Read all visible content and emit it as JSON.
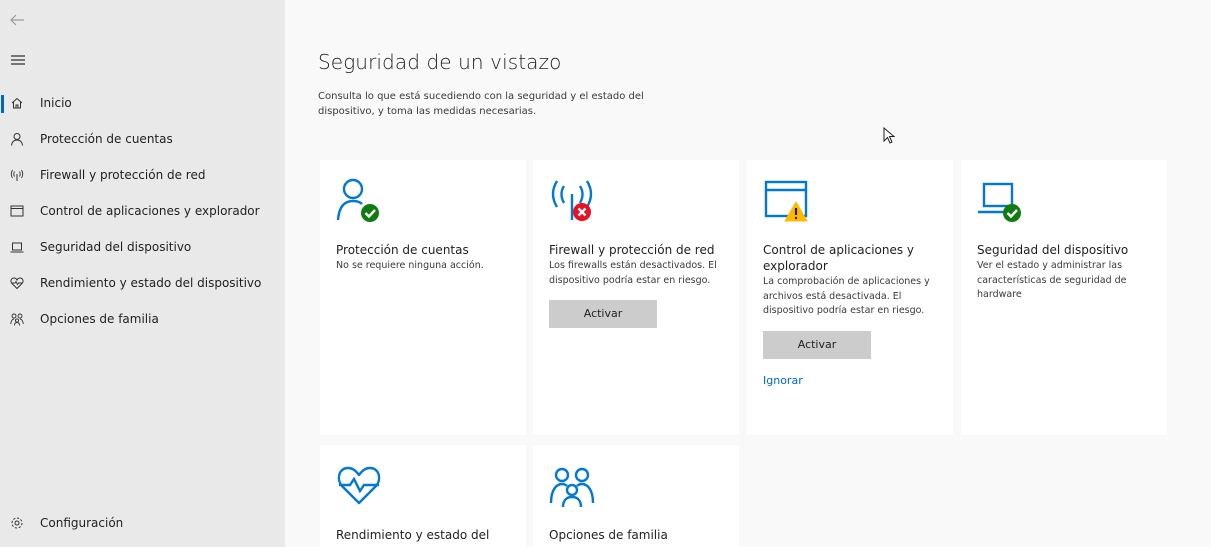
{
  "sidebar": {
    "items": [
      {
        "label": "Inicio",
        "icon": "home-icon",
        "active": true
      },
      {
        "label": "Protección de cuentas",
        "icon": "person-icon"
      },
      {
        "label": "Firewall y protección de red",
        "icon": "antenna-icon"
      },
      {
        "label": "Control de aplicaciones y explorador",
        "icon": "browser-window-icon"
      },
      {
        "label": "Seguridad del dispositivo",
        "icon": "laptop-icon"
      },
      {
        "label": "Rendimiento y estado del dispositivo",
        "icon": "heart-pulse-icon"
      },
      {
        "label": "Opciones de familia",
        "icon": "family-icon"
      }
    ],
    "settings_label": "Configuración"
  },
  "main": {
    "title": "Seguridad de un vistazo",
    "subtitle": "Consulta lo que está sucediendo con la seguridad y el estado del dispositivo, y toma las medidas necesarias.",
    "cards": [
      {
        "title": "Protección de cuentas",
        "description": "No se requiere ninguna acción.",
        "status": "ok"
      },
      {
        "title": "Firewall y protección de red",
        "description": "Los firewalls están desactivados. El dispositivo podría estar en riesgo.",
        "button": "Activar",
        "status": "error"
      },
      {
        "title": "Control de aplicaciones y explorador",
        "description": "La comprobación de aplicaciones y archivos está desactivada. El dispositivo podría estar en riesgo.",
        "button": "Activar",
        "link": "Ignorar",
        "status": "warning"
      },
      {
        "title": "Seguridad del dispositivo",
        "description": "Ver el estado y administrar las características de seguridad de hardware",
        "status": "ok"
      },
      {
        "title": "Rendimiento y estado del"
      },
      {
        "title": "Opciones de familia"
      }
    ]
  },
  "colors": {
    "accent": "#0067c0",
    "ok": "#107c10",
    "error": "#e81123",
    "warning": "#ffb900",
    "sidebar_bg": "#e9e9e9",
    "card_bg": "#ffffff"
  }
}
